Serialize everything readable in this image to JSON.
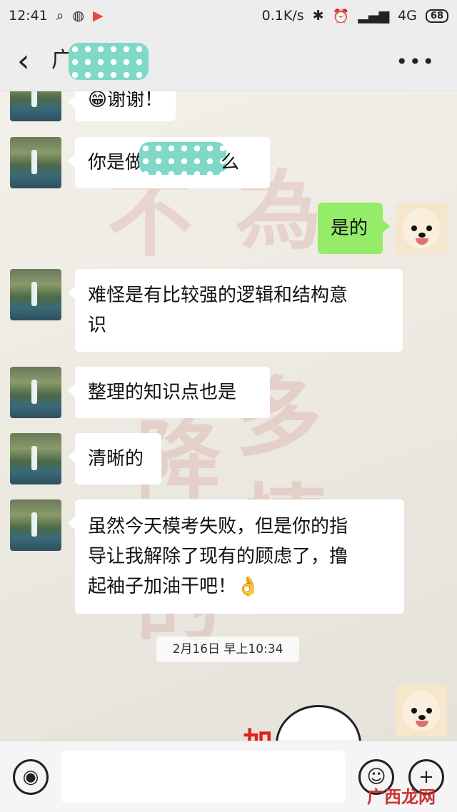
{
  "status_bar": {
    "time": "12:41",
    "speed": "0.1K/s",
    "network": "4G",
    "battery": "68"
  },
  "header": {
    "contact_name_visible": "广"
  },
  "messages": [
    {
      "side": "left",
      "text": "😁谢谢！"
    },
    {
      "side": "left",
      "text_prefix": "你是做",
      "text_suffix": "么"
    },
    {
      "side": "right",
      "text": "是的"
    },
    {
      "side": "left",
      "line1": "难怪是有比较强的逻辑和结构意",
      "line2": "识"
    },
    {
      "side": "left",
      "text": "整理的知识点也是"
    },
    {
      "side": "left",
      "text": "清晰的"
    },
    {
      "side": "left",
      "line1": "虽然今天模考失败，但是你的指",
      "line2": "导让我解除了现有的顾虑了，撸",
      "line3": "起袖子加油干吧！👌"
    }
  ],
  "timestamp": "2月16日 早上10:34",
  "sticker": {
    "text": "加"
  },
  "input_bar": {
    "placeholder": ""
  },
  "watermark": "广西龙网"
}
